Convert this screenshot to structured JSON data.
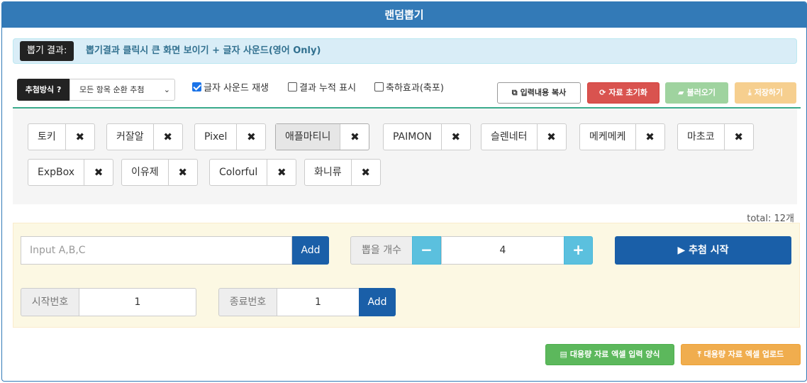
{
  "header": {
    "title": "랜덤뽑기"
  },
  "result": {
    "tag_label": "뽑기 결과:",
    "message": "뽑기결과 클릭시 큰 화면 보이기 + 글자 사운드(영어 Only)"
  },
  "method": {
    "label": "추첨방식 ?",
    "selected": "모든 항목 순환 추첨"
  },
  "options": {
    "sound_label": "글자 사운드 재생",
    "sound_checked": true,
    "cumulative_label": "결과 누적 표시",
    "cumulative_checked": false,
    "celebrate_label": "축하효과(축포)",
    "celebrate_checked": false
  },
  "toolbar": {
    "copy_label": "입력내용 복사",
    "reset_label": "자료 초기화",
    "load_label": "불러오기",
    "save_label": "저장하기"
  },
  "items": [
    "토키",
    "커잘알",
    "Pixel",
    "애플마티니",
    "PAIMON",
    "슬렌네터",
    "메케메케",
    "마초코",
    "ExpBox",
    "이유제",
    "Colorful",
    "화니류"
  ],
  "active_item": "애플마티니",
  "total": "total: 12개",
  "input": {
    "placeholder": "Input A,B,C",
    "add_label": "Add",
    "count_label": "뽑을 개수",
    "count_value": "4",
    "minus": "−",
    "plus": "+",
    "start_label": "▶ 추첨 시작",
    "start_no_label": "시작번호",
    "start_no_value": "1",
    "end_no_label": "종료번호",
    "end_no_value": "1",
    "range_add_label": "Add"
  },
  "bottom": {
    "excel_form_label": "대용량 자료 엑셀 입력 양식",
    "excel_upload_label": "대용량 자료 엑셀 업로드"
  },
  "colors": {
    "header": "#337ab7",
    "danger": "#d9534f",
    "success": "#5cb85c",
    "warning": "#f0ad4e",
    "info": "#5bc0de",
    "primary_dark": "#1a5fa8"
  }
}
